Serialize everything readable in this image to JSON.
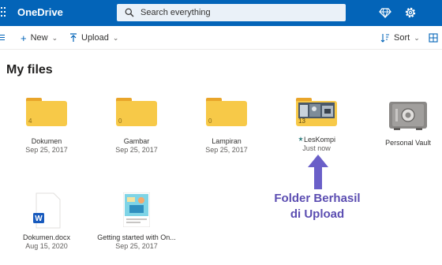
{
  "app": {
    "title": "OneDrive"
  },
  "search": {
    "placeholder": "Search everything"
  },
  "toolbar": {
    "new_label": "New",
    "upload_label": "Upload",
    "sort_label": "Sort"
  },
  "page": {
    "title": "My files"
  },
  "items": [
    {
      "name": "Dokumen",
      "date": "Sep 25, 2017",
      "count": "4",
      "type": "folder"
    },
    {
      "name": "Gambar",
      "date": "Sep 25, 2017",
      "count": "0",
      "type": "folder"
    },
    {
      "name": "Lampiran",
      "date": "Sep 25, 2017",
      "count": "0",
      "type": "folder"
    },
    {
      "name": "LesKompi",
      "date": "Just now",
      "count": "13",
      "type": "folder"
    },
    {
      "name": "Personal Vault",
      "date": "",
      "type": "vault"
    },
    {
      "name": "Dokumen.docx",
      "date": "Aug 15, 2020",
      "type": "word-file"
    },
    {
      "name": "Getting started with On...",
      "date": "Sep 25, 2017",
      "type": "pdf-file"
    }
  ],
  "annotation": {
    "line1": "Folder Berhasil",
    "line2": "di Upload",
    "color": "#5b4db1"
  },
  "colors": {
    "topbar": "#0364b8",
    "folder": "#f7c948",
    "folder_tab": "#e9a52a",
    "accent": "#0364b8"
  },
  "icons": [
    "app-launcher-icon",
    "search-icon",
    "premium-diamond-icon",
    "settings-gear-icon",
    "nav-menu-icon",
    "plus-icon",
    "upload-arrow-icon",
    "sort-icon",
    "view-grid-icon",
    "vault-icon",
    "word-icon",
    "shared-new-icon"
  ]
}
